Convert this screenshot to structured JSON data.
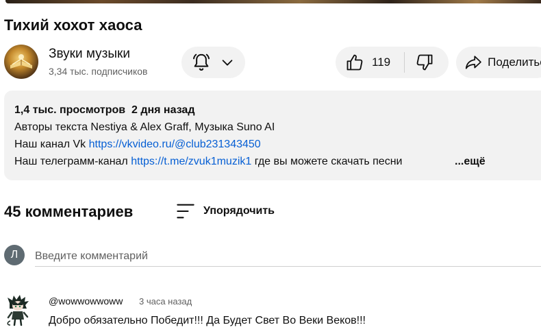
{
  "video": {
    "title": "Тихий хохот хаоса"
  },
  "channel": {
    "name": "Звуки музыки",
    "subscribers": "3,34 тыс. подписчиков",
    "avatar_icon": "golden-book-icon"
  },
  "actions": {
    "like_count": "119",
    "share_label": "Поделиться"
  },
  "description": {
    "meta": "1,4 тыс. просмотров  2 дня назад",
    "line1": "Авторы текста Nestiya & Alex Graff, Музыка Suno AI",
    "line2_prefix": "Наш канал Vk ",
    "line2_link": "https://vkvideo.ru/@club231343450",
    "line3_prefix": "Наш телеграмм-канал ",
    "line3_link": "https://t.me/zvuk1muzik1",
    "line3_suffix": " где вы можете скачать песни",
    "more_label": "...ещё"
  },
  "comments": {
    "count_label": "45 комментариев",
    "sort_label": "Упорядочить",
    "input_placeholder": "Введите комментарий",
    "my_avatar_letter": "Л",
    "items": [
      {
        "author": "@wowwowwoww",
        "time": "3 часа назад",
        "text": "Добро обязательно Победит!!! Да Будет Свет Во Веки Веков!!!"
      }
    ]
  },
  "colors": {
    "link": "#065fd4",
    "pill_bg": "#f2f2f2",
    "secondary_text": "#606060"
  }
}
